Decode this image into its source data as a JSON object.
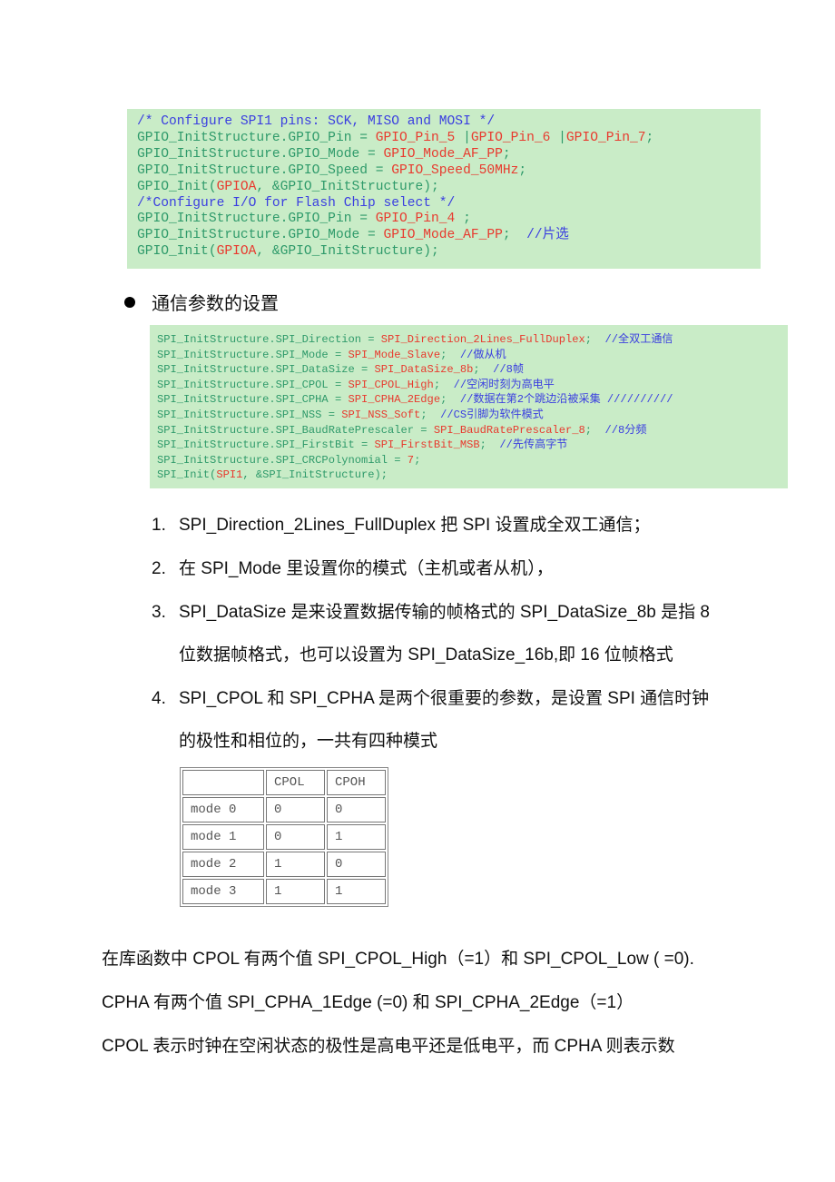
{
  "code_block_1": {
    "lines": [
      [
        {
          "t": "/* Configure SPI1 pins: SCK, MISO and MOSI */",
          "c": "b"
        }
      ],
      [
        {
          "t": "GPIO_InitStructure.GPIO_Pin = ",
          "c": "g"
        },
        {
          "t": "GPIO_Pin_5",
          "c": "r"
        },
        {
          "t": " |",
          "c": "g"
        },
        {
          "t": "GPIO_Pin_6",
          "c": "r"
        },
        {
          "t": " |",
          "c": "g"
        },
        {
          "t": "GPIO_Pin_7",
          "c": "r"
        },
        {
          "t": ";",
          "c": "g"
        }
      ],
      [
        {
          "t": "GPIO_InitStructure.GPIO_Mode = ",
          "c": "g"
        },
        {
          "t": "GPIO_Mode_AF_PP",
          "c": "r"
        },
        {
          "t": ";",
          "c": "g"
        }
      ],
      [
        {
          "t": "GPIO_InitStructure.GPIO_Speed = ",
          "c": "g"
        },
        {
          "t": "GPIO_Speed_50MHz",
          "c": "r"
        },
        {
          "t": ";",
          "c": "g"
        }
      ],
      [
        {
          "t": "GPIO_Init(",
          "c": "g"
        },
        {
          "t": "GPIOA",
          "c": "r"
        },
        {
          "t": ", &GPIO_InitStructure);",
          "c": "g"
        }
      ],
      [
        {
          "t": "/*Configure I/O for Flash Chip select */",
          "c": "b"
        }
      ],
      [
        {
          "t": "GPIO_InitStructure.GPIO_Pin = ",
          "c": "g"
        },
        {
          "t": "GPIO_Pin_4",
          "c": "r"
        },
        {
          "t": " ;",
          "c": "g"
        }
      ],
      [
        {
          "t": "GPIO_InitStructure.GPIO_Mode = ",
          "c": "g"
        },
        {
          "t": "GPIO_Mode_AF_PP",
          "c": "r"
        },
        {
          "t": ";  ",
          "c": "g"
        },
        {
          "t": "//片选",
          "c": "b"
        }
      ],
      [
        {
          "t": "GPIO_Init(",
          "c": "g"
        },
        {
          "t": "GPIOA",
          "c": "r"
        },
        {
          "t": ", &GPIO_InitStructure);",
          "c": "g"
        }
      ]
    ]
  },
  "section_heading": "通信参数的设置",
  "code_block_2": {
    "lines": [
      [
        {
          "t": "SPI_InitStructure.SPI_Direction = ",
          "c": "g"
        },
        {
          "t": "SPI_Direction_2Lines_FullDuplex",
          "c": "r"
        },
        {
          "t": ";  ",
          "c": "g"
        },
        {
          "t": "//全双工通信",
          "c": "b"
        }
      ],
      [
        {
          "t": "SPI_InitStructure.SPI_Mode = ",
          "c": "g"
        },
        {
          "t": "SPI_Mode_Slave",
          "c": "r"
        },
        {
          "t": ";  ",
          "c": "g"
        },
        {
          "t": "//做从机",
          "c": "b"
        }
      ],
      [
        {
          "t": "SPI_InitStructure.SPI_DataSize = ",
          "c": "g"
        },
        {
          "t": "SPI_DataSize_8b",
          "c": "r"
        },
        {
          "t": ";  ",
          "c": "g"
        },
        {
          "t": "//8帧",
          "c": "b"
        }
      ],
      [
        {
          "t": "SPI_InitStructure.SPI_CPOL = ",
          "c": "g"
        },
        {
          "t": "SPI_CPOL_High",
          "c": "r"
        },
        {
          "t": ";  ",
          "c": "g"
        },
        {
          "t": "//空闲时刻为高电平",
          "c": "b"
        }
      ],
      [
        {
          "t": "SPI_InitStructure.SPI_CPHA = ",
          "c": "g"
        },
        {
          "t": "SPI_CPHA_2Edge",
          "c": "r"
        },
        {
          "t": ";  ",
          "c": "g"
        },
        {
          "t": "//数据在第2个跳边沿被采集 //////////",
          "c": "b"
        }
      ],
      [
        {
          "t": "SPI_InitStructure.SPI_NSS = ",
          "c": "g"
        },
        {
          "t": "SPI_NSS_Soft",
          "c": "r"
        },
        {
          "t": ";  ",
          "c": "g"
        },
        {
          "t": "//CS引脚为软件模式",
          "c": "b"
        }
      ],
      [
        {
          "t": "SPI_InitStructure.SPI_BaudRatePrescaler = ",
          "c": "g"
        },
        {
          "t": "SPI_BaudRatePrescaler_8",
          "c": "r"
        },
        {
          "t": ";  ",
          "c": "g"
        },
        {
          "t": "//8分频",
          "c": "b"
        }
      ],
      [
        {
          "t": "SPI_InitStructure.SPI_FirstBit = ",
          "c": "g"
        },
        {
          "t": "SPI_FirstBit_MSB",
          "c": "r"
        },
        {
          "t": ";  ",
          "c": "g"
        },
        {
          "t": "//先传高字节",
          "c": "b"
        }
      ],
      [
        {
          "t": "SPI_InitStructure.SPI_CRCPolynomial = ",
          "c": "g"
        },
        {
          "t": "7",
          "c": "r"
        },
        {
          "t": ";",
          "c": "g"
        }
      ],
      [
        {
          "t": "SPI_Init(",
          "c": "g"
        },
        {
          "t": "SPI1",
          "c": "r"
        },
        {
          "t": ", &SPI_InitStructure);",
          "c": "g"
        }
      ]
    ]
  },
  "list": [
    {
      "num": "1.",
      "lines": [
        "SPI_Direction_2Lines_FullDuplex 把 SPI 设置成全双工通信；"
      ]
    },
    {
      "num": "2.",
      "lines": [
        "在 SPI_Mode  里设置你的模式（主机或者从机），"
      ]
    },
    {
      "num": "3.",
      "lines": [
        "SPI_DataSize 是来设置数据传输的帧格式的 SPI_DataSize_8b 是指 8",
        "位数据帧格式，也可以设置为 SPI_DataSize_16b,即 16 位帧格式"
      ]
    },
    {
      "num": "4.",
      "lines": [
        "SPI_CPOL 和 SPI_CPHA 是两个很重要的参数，是设置 SPI 通信时钟",
        "的极性和相位的，一共有四种模式"
      ]
    }
  ],
  "mode_table": {
    "headers": [
      "",
      "CPOL",
      "CPOH"
    ],
    "rows": [
      [
        "mode 0",
        "0",
        "0"
      ],
      [
        "mode 1",
        "0",
        "1"
      ],
      [
        "mode 2",
        "1",
        "0"
      ],
      [
        "mode 3",
        "1",
        "1"
      ]
    ]
  },
  "paragraphs": [
    "在库函数中  CPOL 有两个值 SPI_CPOL_High（=1）和 SPI_CPOL_Low ( =0).",
    "CPHA 有两个值 SPI_CPHA_1Edge (=0)  和 SPI_CPHA_2Edge（=1）",
    "CPOL 表示时钟在空闲状态的极性是高电平还是低电平，而 CPHA 则表示数"
  ],
  "colors": {
    "code_background": "#c9ecc7",
    "identifier": "#2e9a6a",
    "value": "#e83a2e",
    "comment": "#3a3ee0"
  }
}
